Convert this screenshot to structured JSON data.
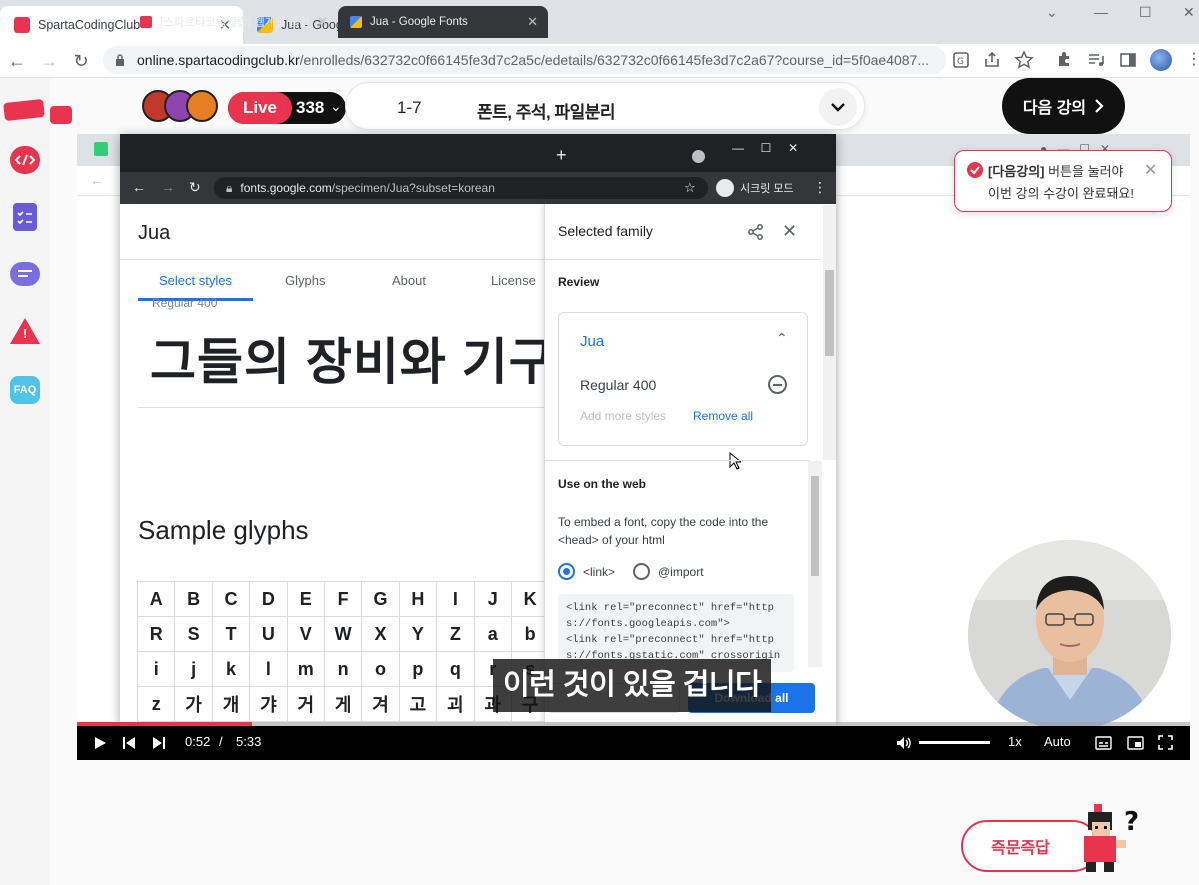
{
  "browser": {
    "tabs": [
      {
        "title": "SpartaCodingClub",
        "active": true
      },
      {
        "title": "Jua - Google Fonts",
        "active": false
      }
    ],
    "url_host": "online.spartacodingclub.kr",
    "url_path": "/enrolleds/632732c0f66145fe3d7c2a5c/edetails/632732c0f66145fe3d7c2a67?course_id=5f0ae4087..."
  },
  "header": {
    "live_label": "Live",
    "live_count": "338",
    "lesson_number": "1-7",
    "lesson_title": "폰트, 주석, 파일분리",
    "next_button": "다음 강의"
  },
  "leftrail": {
    "faq_label": "FAQ"
  },
  "toast": {
    "bold": "[다음강의]",
    "line1_rest": " 버튼을 눌러야",
    "line2": "이번 강의 수강이 완료돼요!"
  },
  "video": {
    "inner_browser": {
      "tab1": "[스파르타코딩클럽] 웹개발 종합",
      "tab2": "Jua - Google Fonts",
      "url_host": "fonts.google.com",
      "url_path": "/specimen/Jua?subset=korean",
      "incognito": "시크릿 모드"
    },
    "google_fonts": {
      "font_name": "Jua",
      "tabs": [
        "Select styles",
        "Glyphs",
        "About",
        "License"
      ],
      "style_label": "Regular 400",
      "sample_text": "그들의 장비와 기구",
      "glyphs_title": "Sample glyphs",
      "glyphs": [
        "A",
        "B",
        "C",
        "D",
        "E",
        "F",
        "G",
        "H",
        "I",
        "J",
        "K",
        "R",
        "S",
        "T",
        "U",
        "V",
        "W",
        "X",
        "Y",
        "Z",
        "a",
        "b",
        "i",
        "j",
        "k",
        "l",
        "m",
        "n",
        "o",
        "p",
        "q",
        "r",
        "s",
        "z",
        "가",
        "개",
        "갸",
        "거",
        "게",
        "겨",
        "고",
        "괴",
        "과",
        "구"
      ]
    },
    "selected_family": {
      "title": "Selected family",
      "review": "Review",
      "family": "Jua",
      "style": "Regular 400",
      "add_more": "Add more styles",
      "remove_all": "Remove all",
      "use_on_web": "Use on the web",
      "embed_text": "To embed a font, copy the code into the <head> of your html",
      "radio_link": "<link>",
      "radio_import": "@import",
      "code": "<link rel=\"preconnect\" href=\"http\ns://fonts.googleapis.com\">\n<link rel=\"preconnect\" href=\"http\ns://fonts.gstatic.com\" crossorigin",
      "download_all": "Download all"
    },
    "subtitle": "이런 것이 있을 겁니다",
    "player": {
      "current_time": "0:52",
      "separator": "/",
      "duration": "5:33",
      "progress": 0.157,
      "speed": "1x",
      "quality": "Auto"
    }
  },
  "qa_button": "즉문즉답",
  "colors": {
    "brand_red": "#e8344e",
    "google_blue": "#1a73e8"
  }
}
